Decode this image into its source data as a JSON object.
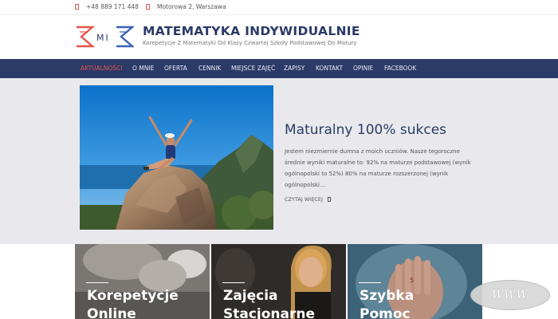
{
  "topbar": {
    "phone": "+48 889 171 448",
    "address": "Motorowa 2, Warszawa"
  },
  "header": {
    "logo_text": "MI",
    "title": "MATEMATYKA INDYWIDUALNIE",
    "subtitle": "Korepetycje Z Matematyki Od Klasy Czwartej Szkoły Podstawowej Do Matury"
  },
  "nav": {
    "items": [
      {
        "label": "AKTUALNOŚCI"
      },
      {
        "label": "O MNIE"
      },
      {
        "label": "OFERTA"
      },
      {
        "label": "CENNIK"
      },
      {
        "label": "MIEJSCE ZAJĘĆ"
      },
      {
        "label": "ZAPISY"
      },
      {
        "label": "KONTAKT"
      },
      {
        "label": "OPINIE"
      },
      {
        "label": "FACEBOOK"
      }
    ]
  },
  "post": {
    "title": "Maturalny 100% sukces",
    "excerpt": "Jestem niezmiernie dumna z moich uczniów. Nasze tegoroczne średnie wyniki maturalne to: 92% na maturze podstawowej (wynik ogólnopolski to 52%) 80% na maturze rozszerzonej  (wynik ogólnopolski…",
    "read_more": "CZYTAJ WIĘCEJ"
  },
  "tiles": [
    {
      "label": "Korepetycje\nOnline"
    },
    {
      "label": "Zajęcia\nStacjonarne"
    },
    {
      "label": "Szybka\nPomoc"
    }
  ],
  "badge": {
    "label": "WWW"
  },
  "colors": {
    "brand": "#2b3a67",
    "accent": "#e2574c",
    "hero_bg": "#e9e9ed"
  }
}
